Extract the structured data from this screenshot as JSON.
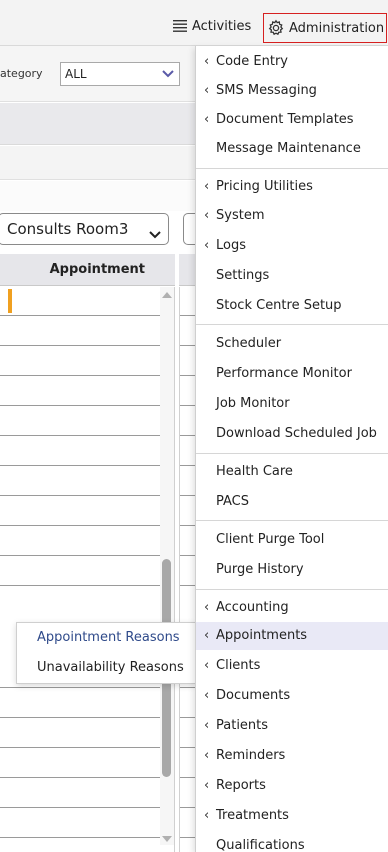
{
  "topbar": {
    "activities_label": "Activities",
    "administration_label": "Administration",
    "accent_border": "#d62020"
  },
  "filter": {
    "category_label": "ategory",
    "category_value": "ALL"
  },
  "room_select": {
    "value": "Consults Room3"
  },
  "grid": {
    "column_header": "Appointment"
  },
  "submenu": {
    "items": [
      {
        "label": "Appointment Reasons"
      },
      {
        "label": "Unavailability Reasons"
      }
    ]
  },
  "admin_menu": {
    "items": [
      {
        "label": "Code Entry",
        "has_submenu": true
      },
      {
        "label": "SMS Messaging",
        "has_submenu": true
      },
      {
        "label": "Document Templates",
        "has_submenu": true
      },
      {
        "label": "Message Maintenance",
        "has_submenu": false
      },
      {
        "label": "Pricing Utilities",
        "has_submenu": true
      },
      {
        "label": "System",
        "has_submenu": true
      },
      {
        "label": "Logs",
        "has_submenu": true
      },
      {
        "label": "Settings",
        "has_submenu": false
      },
      {
        "label": "Stock Centre Setup",
        "has_submenu": false
      },
      {
        "label": "Scheduler",
        "has_submenu": false
      },
      {
        "label": "Performance Monitor",
        "has_submenu": false
      },
      {
        "label": "Job Monitor",
        "has_submenu": false
      },
      {
        "label": "Download Scheduled Job",
        "has_submenu": false
      },
      {
        "label": "Health Care",
        "has_submenu": false
      },
      {
        "label": "PACS",
        "has_submenu": false
      },
      {
        "label": "Client Purge Tool",
        "has_submenu": false
      },
      {
        "label": "Purge History",
        "has_submenu": false
      },
      {
        "label": "Accounting",
        "has_submenu": true
      },
      {
        "label": "Appointments",
        "has_submenu": true,
        "highlighted": true
      },
      {
        "label": "Clients",
        "has_submenu": true
      },
      {
        "label": "Documents",
        "has_submenu": true
      },
      {
        "label": "Patients",
        "has_submenu": true
      },
      {
        "label": "Reminders",
        "has_submenu": true
      },
      {
        "label": "Reports",
        "has_submenu": true
      },
      {
        "label": "Treatments",
        "has_submenu": true
      },
      {
        "label": "Qualifications",
        "has_submenu": false
      }
    ],
    "highlight_color": "#e9e9f6"
  }
}
